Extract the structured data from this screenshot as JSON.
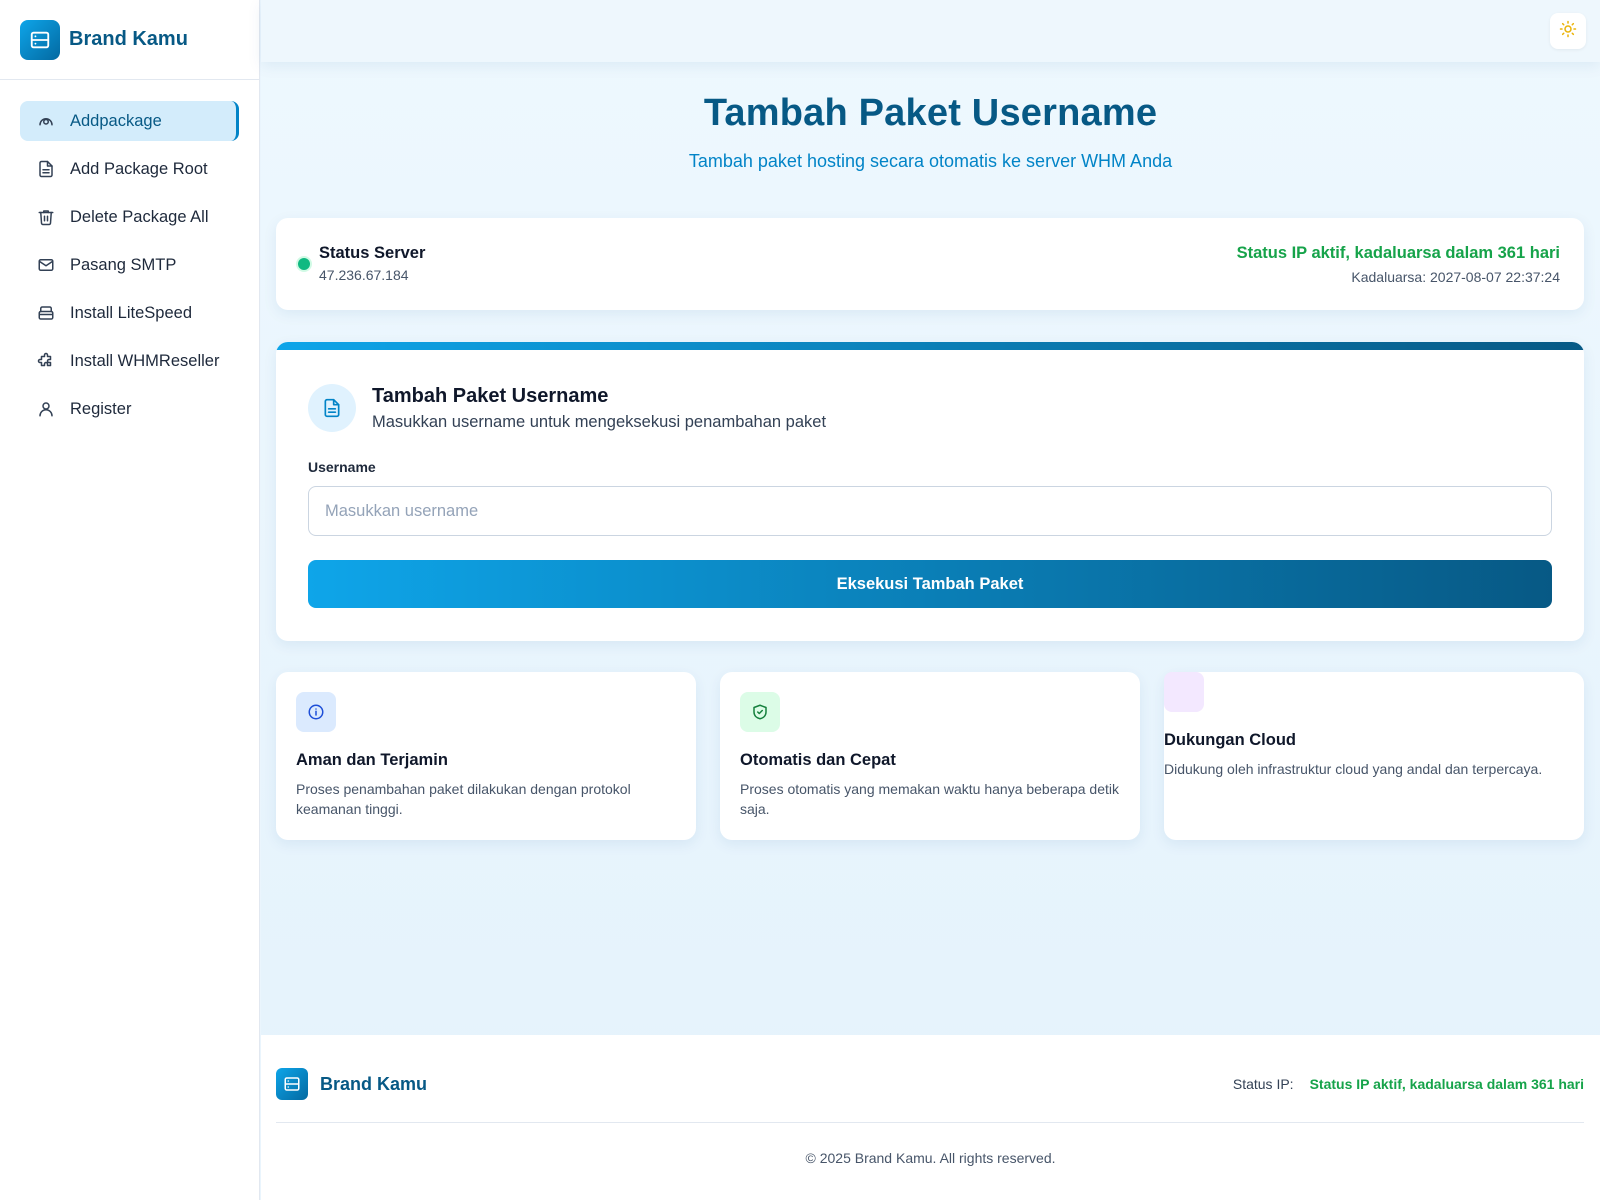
{
  "brand": {
    "name": "Brand Kamu",
    "color": "#075985",
    "accent": "#0ea5e9"
  },
  "sidebar": {
    "items": [
      {
        "label": "Addpackage",
        "icon": "gauge-icon",
        "active": true
      },
      {
        "label": "Add Package Root",
        "icon": "file-icon",
        "active": false
      },
      {
        "label": "Delete Package All",
        "icon": "trash-icon",
        "active": false
      },
      {
        "label": "Pasang SMTP",
        "icon": "mail-icon",
        "active": false
      },
      {
        "label": "Install LiteSpeed",
        "icon": "server-icon",
        "active": false
      },
      {
        "label": "Install WHMReseller",
        "icon": "puzzle-icon",
        "active": false
      },
      {
        "label": "Register",
        "icon": "user-icon",
        "active": false
      }
    ]
  },
  "topbar": {
    "theme_toggle_icon": "sun-icon"
  },
  "hero": {
    "title": "Tambah Paket Username",
    "subtitle": "Tambah paket hosting secara otomatis ke server WHM Anda"
  },
  "status": {
    "title": "Status Server",
    "ip": "47.236.67.184",
    "active_text": "Status IP aktif, kadaluarsa dalam 361 hari",
    "expiry": "Kadaluarsa: 2027-08-07 22:37:24",
    "status_color": "#16a34a"
  },
  "form": {
    "title": "Tambah Paket Username",
    "subtitle": "Masukkan username untuk mengeksekusi penambahan paket",
    "field_label": "Username",
    "field_value": "",
    "field_placeholder": "Masukkan username",
    "submit_label": "Eksekusi Tambah Paket"
  },
  "features": [
    {
      "title": "Aman dan Terjamin",
      "description": "Proses penambahan paket dilakukan dengan protokol keamanan tinggi.",
      "icon": "info-icon",
      "icon_bg": "#dbeafe"
    },
    {
      "title": "Otomatis dan Cepat",
      "description": "Proses otomatis yang memakan waktu hanya beberapa detik saja.",
      "icon": "shield-check-icon",
      "icon_bg": "#dcfce7"
    },
    {
      "title": "Dukungan Cloud",
      "description": "Didukung oleh infrastruktur cloud yang andal dan terpercaya.",
      "icon": "cloud-icon",
      "icon_bg": "#f3e8ff"
    }
  ],
  "footer": {
    "brand_name": "Brand Kamu",
    "status_label": "Status IP:",
    "status_value": "Status IP aktif, kadaluarsa dalam 361 hari",
    "copyright": "© 2025 Brand Kamu. All rights reserved."
  }
}
